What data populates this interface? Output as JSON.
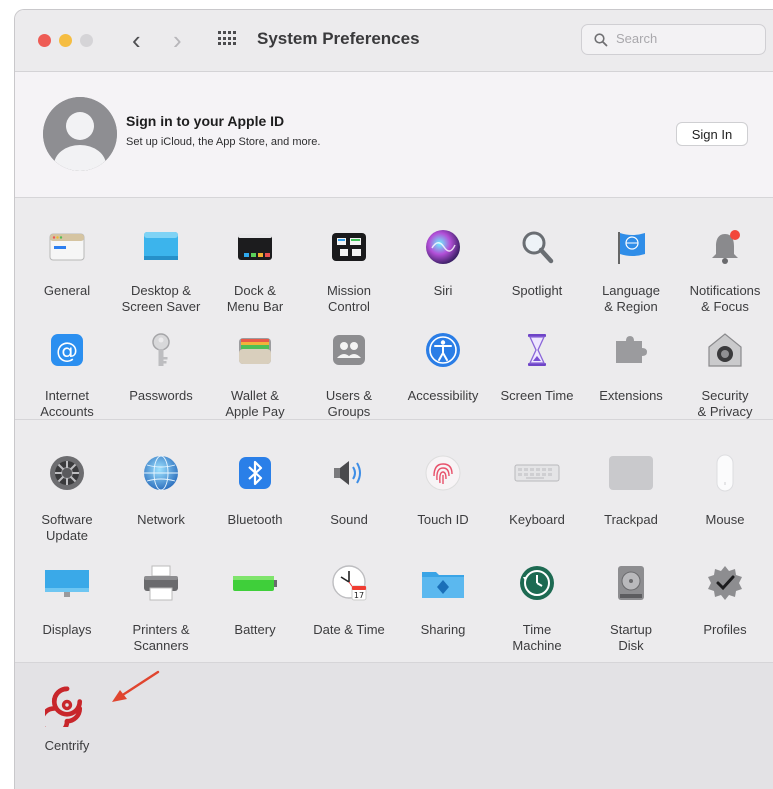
{
  "toolbar": {
    "title": "System Preferences",
    "search_placeholder": "Search"
  },
  "apple_id": {
    "heading": "Sign in to your Apple ID",
    "subtext": "Set up iCloud, the App Store, and more.",
    "button": "Sign In"
  },
  "row1": [
    {
      "label": "General",
      "icon": "general-icon"
    },
    {
      "label": "Desktop &\nScreen Saver",
      "icon": "desktop-screensaver-icon"
    },
    {
      "label": "Dock &\nMenu Bar",
      "icon": "dock-menubar-icon"
    },
    {
      "label": "Mission\nControl",
      "icon": "mission-control-icon"
    },
    {
      "label": "Siri",
      "icon": "siri-icon"
    },
    {
      "label": "Spotlight",
      "icon": "spotlight-icon"
    },
    {
      "label": "Language\n& Region",
      "icon": "language-region-icon"
    },
    {
      "label": "Notifications\n& Focus",
      "icon": "notifications-icon"
    }
  ],
  "row2": [
    {
      "label": "Internet\nAccounts",
      "icon": "internet-accounts-icon"
    },
    {
      "label": "Passwords",
      "icon": "passwords-icon"
    },
    {
      "label": "Wallet &\nApple Pay",
      "icon": "wallet-icon"
    },
    {
      "label": "Users &\nGroups",
      "icon": "users-groups-icon"
    },
    {
      "label": "Accessibility",
      "icon": "accessibility-icon"
    },
    {
      "label": "Screen Time",
      "icon": "screen-time-icon"
    },
    {
      "label": "Extensions",
      "icon": "extensions-icon"
    },
    {
      "label": "Security\n& Privacy",
      "icon": "security-privacy-icon"
    }
  ],
  "row3": [
    {
      "label": "Software\nUpdate",
      "icon": "software-update-icon"
    },
    {
      "label": "Network",
      "icon": "network-icon"
    },
    {
      "label": "Bluetooth",
      "icon": "bluetooth-icon"
    },
    {
      "label": "Sound",
      "icon": "sound-icon"
    },
    {
      "label": "Touch ID",
      "icon": "touch-id-icon"
    },
    {
      "label": "Keyboard",
      "icon": "keyboard-icon"
    },
    {
      "label": "Trackpad",
      "icon": "trackpad-icon"
    },
    {
      "label": "Mouse",
      "icon": "mouse-icon"
    }
  ],
  "row4": [
    {
      "label": "Displays",
      "icon": "displays-icon"
    },
    {
      "label": "Printers &\nScanners",
      "icon": "printers-scanners-icon"
    },
    {
      "label": "Battery",
      "icon": "battery-icon"
    },
    {
      "label": "Date & Time",
      "icon": "date-time-icon",
      "calendar_day": "17"
    },
    {
      "label": "Sharing",
      "icon": "sharing-icon"
    },
    {
      "label": "Time\nMachine",
      "icon": "time-machine-icon"
    },
    {
      "label": "Startup\nDisk",
      "icon": "startup-disk-icon"
    },
    {
      "label": "Profiles",
      "icon": "profiles-icon"
    }
  ],
  "row5": [
    {
      "label": "Centrify",
      "icon": "centrify-icon"
    }
  ],
  "colors": {
    "accent_arrow": "#e0452f",
    "centrify": "#c8262b"
  }
}
